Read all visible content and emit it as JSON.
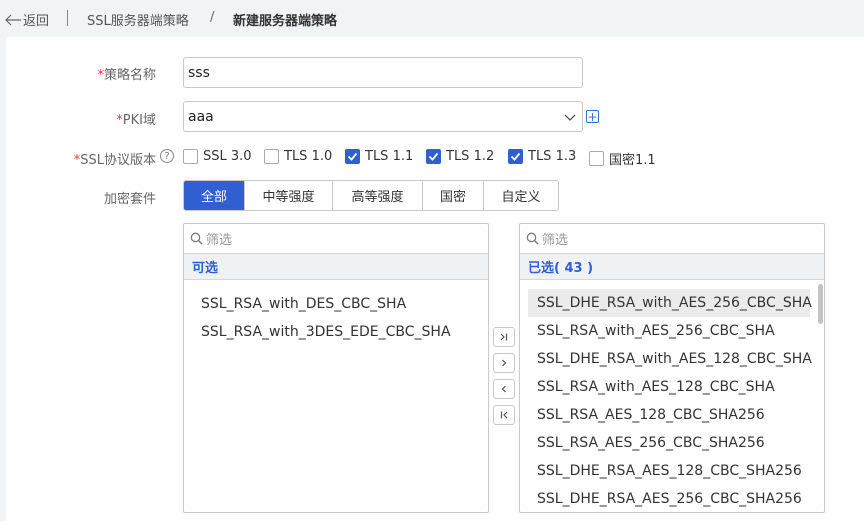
{
  "breadcrumb": {
    "back_label": "返回",
    "parent": "SSL服务器端策略",
    "separator": "/",
    "current": "新建服务器端策略"
  },
  "form": {
    "required_mark": "*",
    "policy_name": {
      "label": "策略名称",
      "value": "sss"
    },
    "pki_domain": {
      "label": "PKI域",
      "value": "aaa",
      "add_icon": "plus-icon"
    },
    "ssl_version": {
      "label": "SSL协议版本",
      "help_icon": "question-circle-icon",
      "help_glyph": "?",
      "options": [
        {
          "label": "SSL 3.0",
          "checked": false
        },
        {
          "label": "TLS 1.0",
          "checked": false
        },
        {
          "label": "TLS 1.1",
          "checked": true
        },
        {
          "label": "TLS 1.2",
          "checked": true
        },
        {
          "label": "TLS 1.3",
          "checked": true
        },
        {
          "label": "国密1.1",
          "checked": false
        }
      ]
    },
    "cipher_suite": {
      "label": "加密套件",
      "tabs": [
        "全部",
        "中等强度",
        "高等强度",
        "国密",
        "自定义"
      ],
      "active_tab": "全部"
    }
  },
  "transfer": {
    "left": {
      "search_placeholder": "筛选",
      "header": "可选",
      "items": [
        "SSL_RSA_with_DES_CBC_SHA",
        "SSL_RSA_with_3DES_EDE_CBC_SHA"
      ]
    },
    "right": {
      "search_placeholder": "筛选",
      "header": "已选( 43 )",
      "items": [
        "SSL_DHE_RSA_with_AES_256_CBC_SHA",
        "SSL_RSA_with_AES_256_CBC_SHA",
        "SSL_DHE_RSA_with_AES_128_CBC_SHA",
        "SSL_RSA_with_AES_128_CBC_SHA",
        "SSL_RSA_AES_128_CBC_SHA256",
        "SSL_RSA_AES_256_CBC_SHA256",
        "SSL_DHE_RSA_AES_128_CBC_SHA256",
        "SSL_DHE_RSA_AES_256_CBC_SHA256"
      ],
      "highlighted_index": 0
    },
    "buttons": [
      "move-all-right-icon",
      "move-right-icon",
      "move-left-icon",
      "move-all-left-icon"
    ]
  },
  "colors": {
    "accent": "#2f5fd0",
    "required": "#e4393c"
  }
}
